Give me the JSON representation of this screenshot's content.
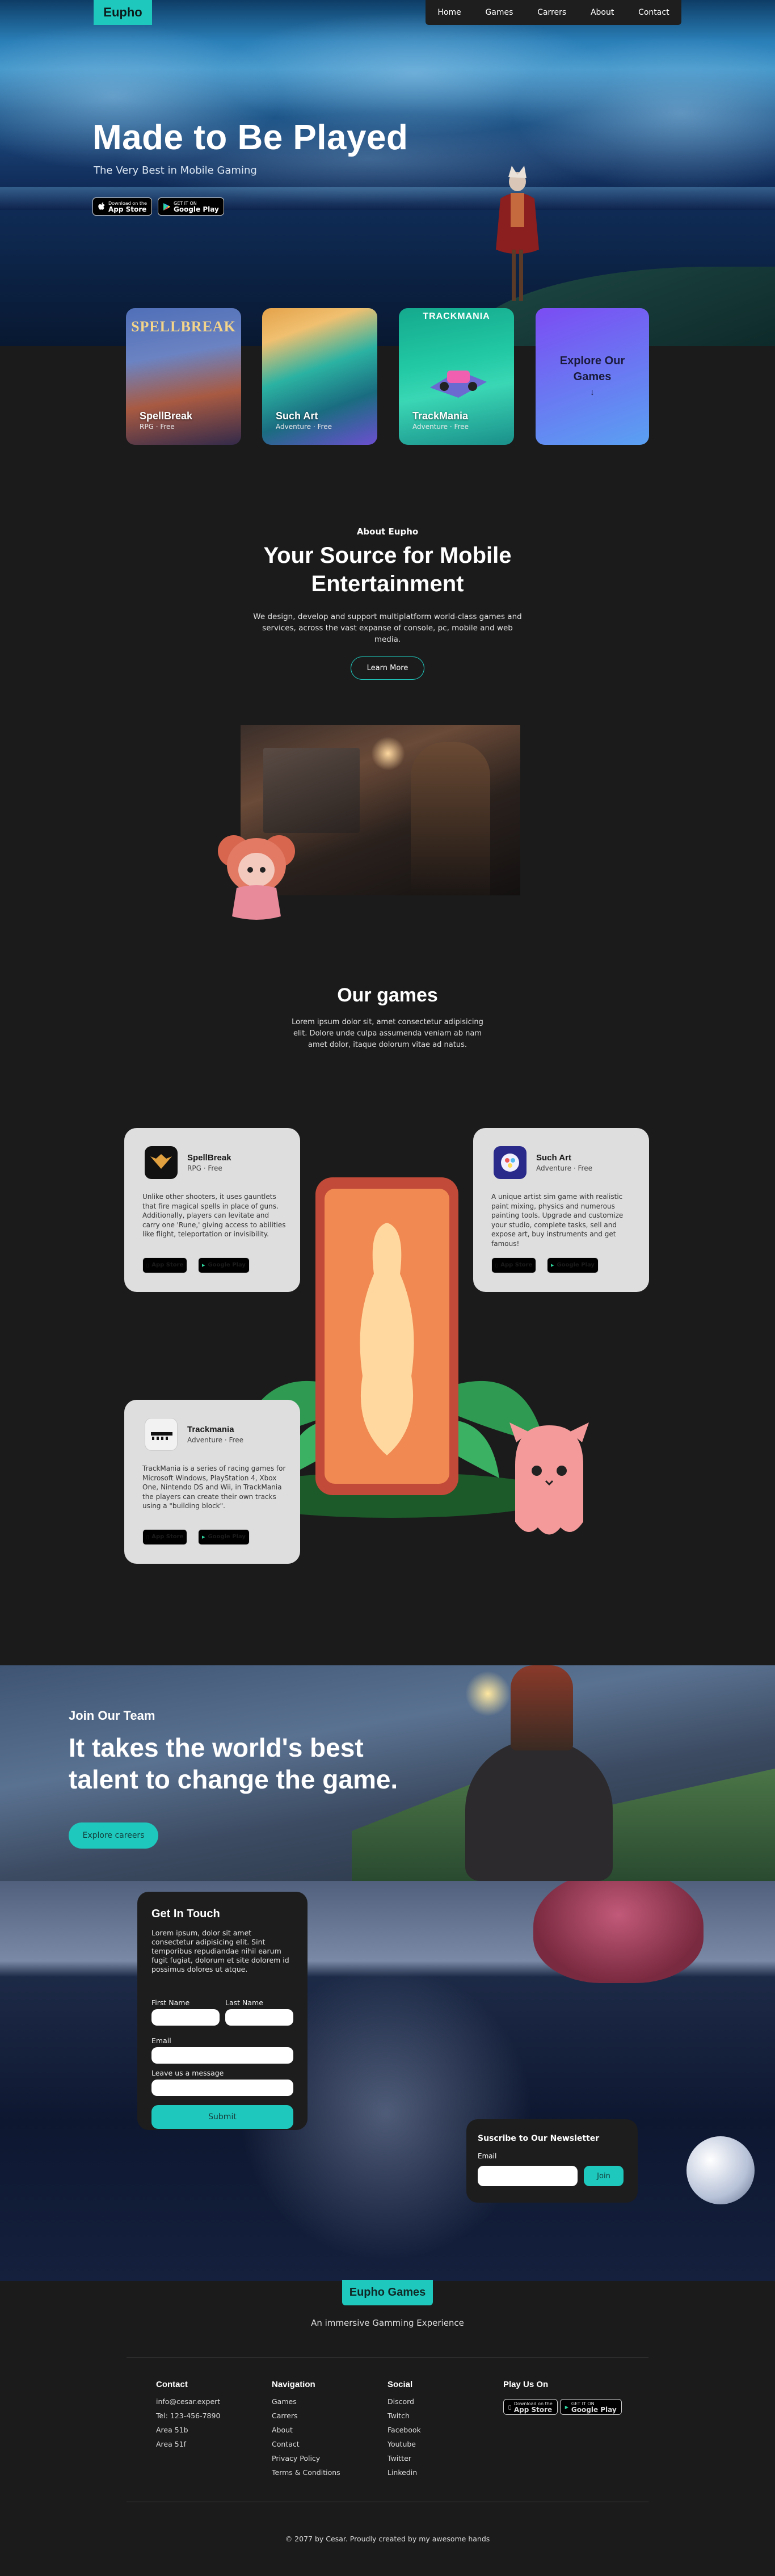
{
  "header": {
    "brand": "Eupho",
    "nav": [
      "Home",
      "Games",
      "Carrers",
      "About",
      "Contact"
    ]
  },
  "hero": {
    "title": "Made to Be Played",
    "subtitle": "The Very Best in Mobile Gaming",
    "app_store": {
      "small": "Download on the",
      "big": "App Store"
    },
    "google_play": {
      "small": "GET IT ON",
      "big": "Google Play"
    }
  },
  "featured": [
    {
      "name": "SpellBreak",
      "genre": "RPG · Free",
      "logo": "SPELLBREAK"
    },
    {
      "name": "Such Art",
      "genre": "Adventure · Free",
      "logo": ""
    },
    {
      "name": "TrackMania",
      "genre": "Adventure · Free",
      "logo": "TRACKMANIA"
    }
  ],
  "explore": {
    "label": "Explore Our Games",
    "arrow": "↓"
  },
  "about": {
    "kicker": "About Eupho",
    "title": "Your Source for Mobile Entertainment",
    "text": "We design, develop and support multiplatform world-class games and services, across the vast expanse of console, pc, mobile and web media.",
    "button": "Learn More"
  },
  "games": {
    "title": "Our games",
    "text": "Lorem ipsum dolor sit, amet consectetur adipisicing elit. Dolore unde culpa assumenda veniam ab nam amet dolor, itaque dolorum vitae ad natus.",
    "cards": [
      {
        "name": "SpellBreak",
        "genre": "RPG · Free",
        "desc": "Unlike other shooters, it uses gauntlets that fire magical spells in place of guns. Additionally, players can levitate and carry one 'Rune,' giving access to abilities like flight, teleportation or invisibility.",
        "app": "App Store",
        "play": "Google Play"
      },
      {
        "name": "Such Art",
        "genre": "Adventure · Free",
        "desc": "A unique artist sim game with realistic paint mixing, physics and numerous painting tools. Upgrade and customize your studio, complete tasks, sell and expose art, buy instruments and get famous!",
        "app": "App Store",
        "play": "Google Play"
      },
      {
        "name": "Trackmania",
        "genre": "Adventure · Free",
        "desc": "TrackMania is a series of racing games for Microsoft Windows, PlayStation 4, Xbox One, Nintendo DS and Wii, in TrackMania the players can create their own tracks using a \"building block\".",
        "app": "App Store",
        "play": "Google Play"
      }
    ]
  },
  "careers": {
    "kicker": "Join Our Team",
    "title": "It takes the world's best talent to change the game.",
    "button": "Explore careers"
  },
  "contact": {
    "title": "Get In Touch",
    "text": "Lorem ipsum, dolor sit amet consectetur adipisicing elit. Sint temporibus repudiandae nihil earum fugit fugiat, dolorum et site dolorem id possimus dolores ut atque.",
    "first": "First Name",
    "last": "Last Name",
    "email": "Email",
    "message": "Leave us a message",
    "submit": "Submit"
  },
  "newsletter": {
    "title": "Suscribe to Our Newsletter",
    "label": "Email",
    "button": "Join"
  },
  "footer": {
    "brand": "Eupho Games",
    "tagline": "An immersive Gamming Experience",
    "contact": {
      "title": "Contact",
      "items": [
        "info@cesar.expert",
        "Tel: 123-456-7890",
        "Area 51b",
        "Area 51f"
      ]
    },
    "navigation": {
      "title": "Navigation",
      "items": [
        "Games",
        "Carrers",
        "About",
        "Contact",
        "Privacy Policy",
        "Terms & Conditions"
      ]
    },
    "social": {
      "title": "Social",
      "items": [
        "Discord",
        "Twitch",
        "Facebook",
        "Youtube",
        "Twitter",
        "Linkedin"
      ]
    },
    "play": {
      "title": "Play Us On"
    },
    "copyright": "© 2077 by Cesar. Proudly created by my awesome hands"
  },
  "colors": {
    "accent": "#1fc8bd",
    "bg": "#1b1b1b",
    "card": "#dedede"
  }
}
